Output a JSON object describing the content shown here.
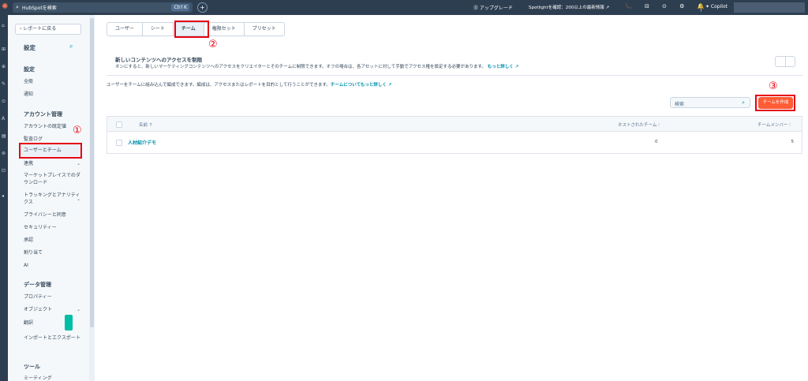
{
  "topbar": {
    "logo": "✺",
    "search_icon": "search-icon",
    "search_placeholder": "HubSpotを検索",
    "search_shortcut": "Ctrl K",
    "add_label": "+",
    "upgrade_label": "⓪ アップグレード",
    "spotlight_label": "Spotlightを確認：200以上の最新情報 ↗",
    "icons_text": "📞 ⊟ ⊙ ⚙ 🔔",
    "copilot_label": "✦ Copilot"
  },
  "rail": {
    "items": [
      "⌂",
      "⊞",
      "⊕",
      "✎",
      "⊙",
      "A",
      "▤",
      "⊚",
      "⊡",
      "◂"
    ]
  },
  "sidebar": {
    "back_label": "‹  レポートに戻る",
    "title": "設定",
    "search_icon": "⌕",
    "sections": [
      {
        "label": "設定"
      },
      {
        "label": "アカウント管理"
      },
      {
        "label": "データ管理"
      },
      {
        "label": "ツール"
      }
    ],
    "items": [
      {
        "label": "全般"
      },
      {
        "label": "通知"
      },
      {
        "label": "アカウントの既定値"
      },
      {
        "label": "監査ログ"
      },
      {
        "label": "ユーザーとチーム"
      },
      {
        "label": "連携",
        "chevron": "⌄"
      },
      {
        "label": "マーケットプレイスでのダウンロード"
      },
      {
        "label": "トラッキングとアナリティクス",
        "chevron": "⌄"
      },
      {
        "label": "プライバシーと同意"
      },
      {
        "label": "セキュリティー"
      },
      {
        "label": "承認"
      },
      {
        "label": "割り当て"
      },
      {
        "label": "AI"
      },
      {
        "label": "プロパティー"
      },
      {
        "label": "オブジェクト",
        "chevron": "⌄"
      },
      {
        "label": "翻訳"
      },
      {
        "label": "インポートとエクスポート"
      },
      {
        "label": "ミーティング"
      }
    ]
  },
  "tabs": [
    "ユーザー",
    "シート",
    "チーム",
    "権限セット",
    "プリセット"
  ],
  "access": {
    "title": "新しいコンテンツへのアクセスを制限",
    "desc": "オンにすると、新しいマーケティングコンテンツへのアクセスをクリエイターとそのチームに制限できます。オフの場合は、各アセットに対して手動でアクセス権を設定する必要があります。",
    "link": "もっと詳しく ↗"
  },
  "info": {
    "text": "ユーザーをチームに組み込んで編成できます。編成は、アクセスまたはレポートを目的として行うことができます。",
    "link": "チームについてもっと詳しく ↗"
  },
  "table": {
    "search_placeholder": "検索",
    "search_icon": "⌕",
    "create_label": "チームを作成",
    "headers": {
      "name": "名前 ↑",
      "nested": "ネストされたチーム ⁝",
      "members": "チームメンバー ⁝"
    },
    "rows": [
      {
        "name": "人材紹介デモ",
        "nested": "0",
        "members": "5"
      }
    ]
  },
  "annotations": {
    "n1": "①",
    "n2": "②",
    "n3": "③",
    "color": "#e60012"
  },
  "colors": {
    "accent": "#ff5c35",
    "link": "#0091ae",
    "nav": "#2d3e50"
  }
}
